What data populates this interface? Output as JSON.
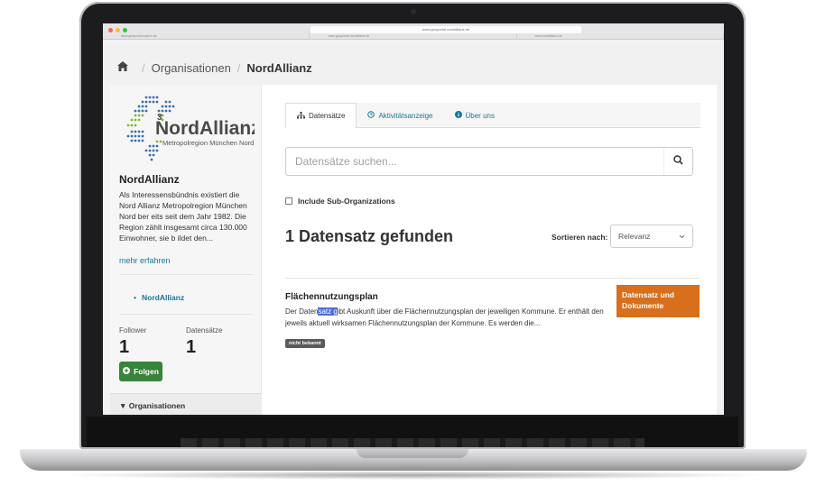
{
  "browser": {
    "url": "www.geoportal.nordallianz.de",
    "tabs": [
      "www.geoportal-bayern.de",
      "www.geoportal-nordallianz.de",
      "www.nordallianz.de"
    ]
  },
  "breadcrumb": {
    "home_icon": "home-icon",
    "organisations": "Organisationen",
    "current": "NordAllianz"
  },
  "sidebar": {
    "logo": {
      "superscript": "3",
      "name": "NordAllianz",
      "tagline": "Metropolregion München Nord"
    },
    "title": "NordAllianz",
    "description": "Als Interessensbündnis existiert die Nord Allianz Metropolregion München Nord ber eits seit dem Jahr 1982. Die Region zählt insgesamt circa 130.000 Einwohner, sie b ildet den...",
    "more_link": "mehr erfahren",
    "org_link": "NordAllianz",
    "followers_label": "Follower",
    "followers_value": "1",
    "datasets_label": "Datensätze",
    "datasets_value": "1",
    "follow_button": "Folgen",
    "organisations_section": "Organisationen"
  },
  "main": {
    "tabs": [
      {
        "label": "Datensätze",
        "icon": "sitemap-icon"
      },
      {
        "label": "Aktivitätsanzeige",
        "icon": "clock-icon"
      },
      {
        "label": "Über uns",
        "icon": "info-icon"
      }
    ],
    "search": {
      "placeholder": "Datensätze suchen...",
      "value": ""
    },
    "include_sub_orgs": "Include Sub-Organizations",
    "result_count": "1 Datensatz gefunden",
    "sort_label": "Sortieren nach:",
    "sort_value": "Relevanz",
    "dataset": {
      "title": "Flächennutzungsplan",
      "desc_before": "Der Daten",
      "desc_highlight": "satz g",
      "desc_after": "ibt Auskunft über die Flächennutzungsplan der jeweiligen Kommune. Er enthält den jeweils aktuell wirksamen Flächennutzungsplan der Kommune. Es werden die...",
      "badge": "nicht bekannt",
      "docs_button": "Datensatz und Dokumente"
    }
  },
  "colors": {
    "link": "#187794",
    "follow_button": "#39833b",
    "docs_button": "#d86f1d",
    "highlight": "#4d6fd4"
  }
}
